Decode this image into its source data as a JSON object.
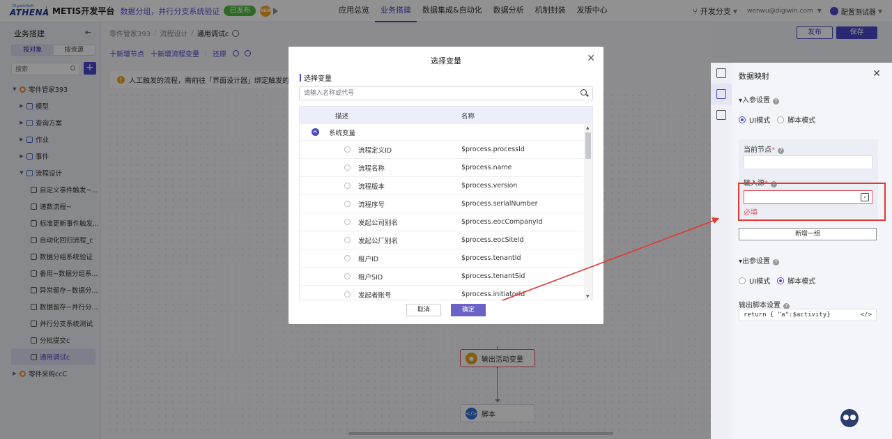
{
  "topbar": {
    "logo_small": "DigiwinSoft",
    "logo_main": "ATHENA",
    "platform": "METIS开发平台",
    "project": "数据分组，并行分支系统验证",
    "status_badge": "已发布",
    "orange_badge": "NEW",
    "nav": [
      "应用总览",
      "业务搭建",
      "数据集成&自动化",
      "数据分析",
      "机制封装",
      "发版中心"
    ],
    "nav_active": "业务搭建",
    "branch": "开发分支",
    "email": "wenwu@digiwin.com",
    "user": "配置测试器"
  },
  "sidebar": {
    "title": "业务搭建",
    "tabs": [
      "按对象",
      "按资源"
    ],
    "search_placeholder": "搜索",
    "tree": [
      {
        "label": "零件管家393",
        "level": 0,
        "arrow": "▼",
        "icon": "orange"
      },
      {
        "label": "模型",
        "level": 1,
        "arrow": "▶",
        "icon": "box"
      },
      {
        "label": "查询方案",
        "level": 1,
        "arrow": "▶",
        "icon": "box"
      },
      {
        "label": "作业",
        "level": 1,
        "arrow": "▶",
        "icon": "box"
      },
      {
        "label": "事件",
        "level": 1,
        "arrow": "▶",
        "icon": "box"
      },
      {
        "label": "流程设计",
        "level": 1,
        "arrow": "▼",
        "icon": "box"
      },
      {
        "label": "自定义事件触发~...",
        "level": 2,
        "icon": "doc"
      },
      {
        "label": "递数流程~",
        "level": 2,
        "icon": "doc"
      },
      {
        "label": "标准更新事件触发...",
        "level": 2,
        "icon": "doc"
      },
      {
        "label": "自动化回归流程_c",
        "level": 2,
        "icon": "doc"
      },
      {
        "label": "数据分组系统验证",
        "level": 2,
        "icon": "doc"
      },
      {
        "label": "备用~数据分组系...",
        "level": 2,
        "icon": "doc"
      },
      {
        "label": "异常留存~数据分...",
        "level": 2,
        "icon": "doc"
      },
      {
        "label": "数据留存~并行分...",
        "level": 2,
        "icon": "doc"
      },
      {
        "label": "并行分支系统测试",
        "level": 2,
        "icon": "doc"
      },
      {
        "label": "分批提交c",
        "level": 2,
        "icon": "doc"
      },
      {
        "label": "通用调试c",
        "level": 2,
        "icon": "doc",
        "selected": true
      },
      {
        "label": "零件采购ccC",
        "level": 0,
        "arrow": "▶",
        "icon": "orange"
      }
    ]
  },
  "main": {
    "breadcrumb": [
      "零件管家393",
      "流程设计",
      "通用调试c"
    ],
    "toolbar": {
      "add_node": "十新增节点",
      "add_var": "十新增流程变量",
      "restore": "还原"
    },
    "notice": "人工触发的流程，需前往「界面设计器」绑定触发的按钮",
    "publish": "发布",
    "save": "保存",
    "nodes": [
      {
        "label": "输出活动变量",
        "icon": "yellow",
        "error": true
      },
      {
        "label": "脚本",
        "icon": "blue",
        "error": false
      }
    ]
  },
  "modal": {
    "title": "选择变量",
    "subtitle": "选择变量",
    "search_placeholder": "请输入名称或代号",
    "col_desc": "描述",
    "col_name": "名称",
    "group": "系统变量",
    "rows": [
      {
        "desc": "流程定义ID",
        "name": "$process.processId"
      },
      {
        "desc": "流程名称",
        "name": "$process.name"
      },
      {
        "desc": "流程版本",
        "name": "$process.version"
      },
      {
        "desc": "流程序号",
        "name": "$process.serialNumber"
      },
      {
        "desc": "发起公司别名",
        "name": "$process.eocCompanyId"
      },
      {
        "desc": "发起公厂别名",
        "name": "$process.eocSiteId"
      },
      {
        "desc": "租户ID",
        "name": "$process.tenantId"
      },
      {
        "desc": "租户SID",
        "name": "$process.tenantSid"
      },
      {
        "desc": "发起者账号",
        "name": "$process.initiatorId"
      }
    ],
    "cancel": "取消",
    "ok": "确定"
  },
  "rpanel": {
    "title": "数据映射",
    "input_settings": "▾入参设置",
    "ui_mode": "UI模式",
    "script_mode": "脚本模式",
    "current_node": "当前节点",
    "input_source": "输入源",
    "required_msg": "必填",
    "add_group": "新增一组",
    "output_settings": "▾出参设置",
    "output_script": "输出脚本设置",
    "script_value": "return {  \"a\":$activity}"
  },
  "colors": {
    "accent": "#4a47c8",
    "error": "#e3545a",
    "badge_green": "#52b944",
    "annotation_red": "#e3382f"
  }
}
